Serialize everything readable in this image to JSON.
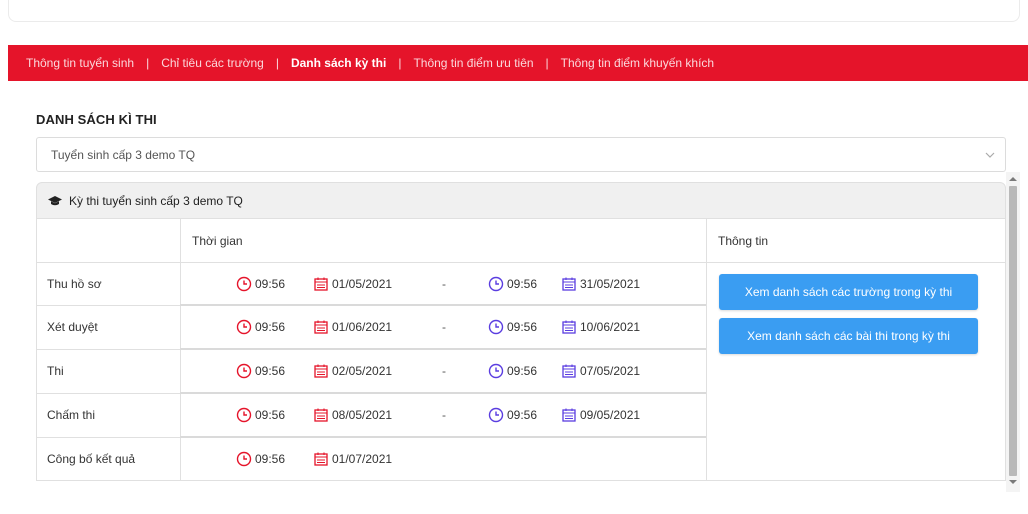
{
  "nav": {
    "items": [
      {
        "label": "Thông tin tuyển sinh",
        "active": false
      },
      {
        "label": "Chỉ tiêu các trường",
        "active": false
      },
      {
        "label": "Danh sách kỳ thi",
        "active": true
      },
      {
        "label": "Thông tin điểm ưu tiên",
        "active": false
      },
      {
        "label": "Thông tin điểm khuyến khích",
        "active": false
      }
    ],
    "separator": "|"
  },
  "section_title": "DANH SÁCH KÌ THI",
  "select": {
    "value": "Tuyển sinh cấp 3 demo TQ"
  },
  "panel": {
    "title": "Kỳ thi tuyển sinh cấp 3 demo TQ",
    "headers": {
      "time": "Thời gian",
      "info": "Thông tin"
    },
    "rows": [
      {
        "label": "Thu hồ sơ",
        "start_time": "09:56",
        "start_date": "01/05/2021",
        "dash": "-",
        "end_time": "09:56",
        "end_date": "31/05/2021"
      },
      {
        "label": "Xét duyệt",
        "start_time": "09:56",
        "start_date": "01/06/2021",
        "dash": "-",
        "end_time": "09:56",
        "end_date": "10/06/2021"
      },
      {
        "label": "Thi",
        "start_time": "09:56",
        "start_date": "02/05/2021",
        "dash": "-",
        "end_time": "09:56",
        "end_date": "07/05/2021"
      },
      {
        "label": "Chấm thi",
        "start_time": "09:56",
        "start_date": "08/05/2021",
        "dash": "-",
        "end_time": "09:56",
        "end_date": "09/05/2021"
      },
      {
        "label": "Công bố kết quả",
        "start_time": "09:56",
        "start_date": "01/07/2021"
      }
    ],
    "buttons": {
      "schools": "Xem danh sách các trường trong kỳ thi",
      "exams": "Xem danh sách các bài thi trong kỳ thi"
    }
  },
  "colors": {
    "brand_red": "#e5142a",
    "button_blue": "#3a9df2",
    "start_icon": "#e5142a",
    "end_icon": "#5a3de0"
  }
}
